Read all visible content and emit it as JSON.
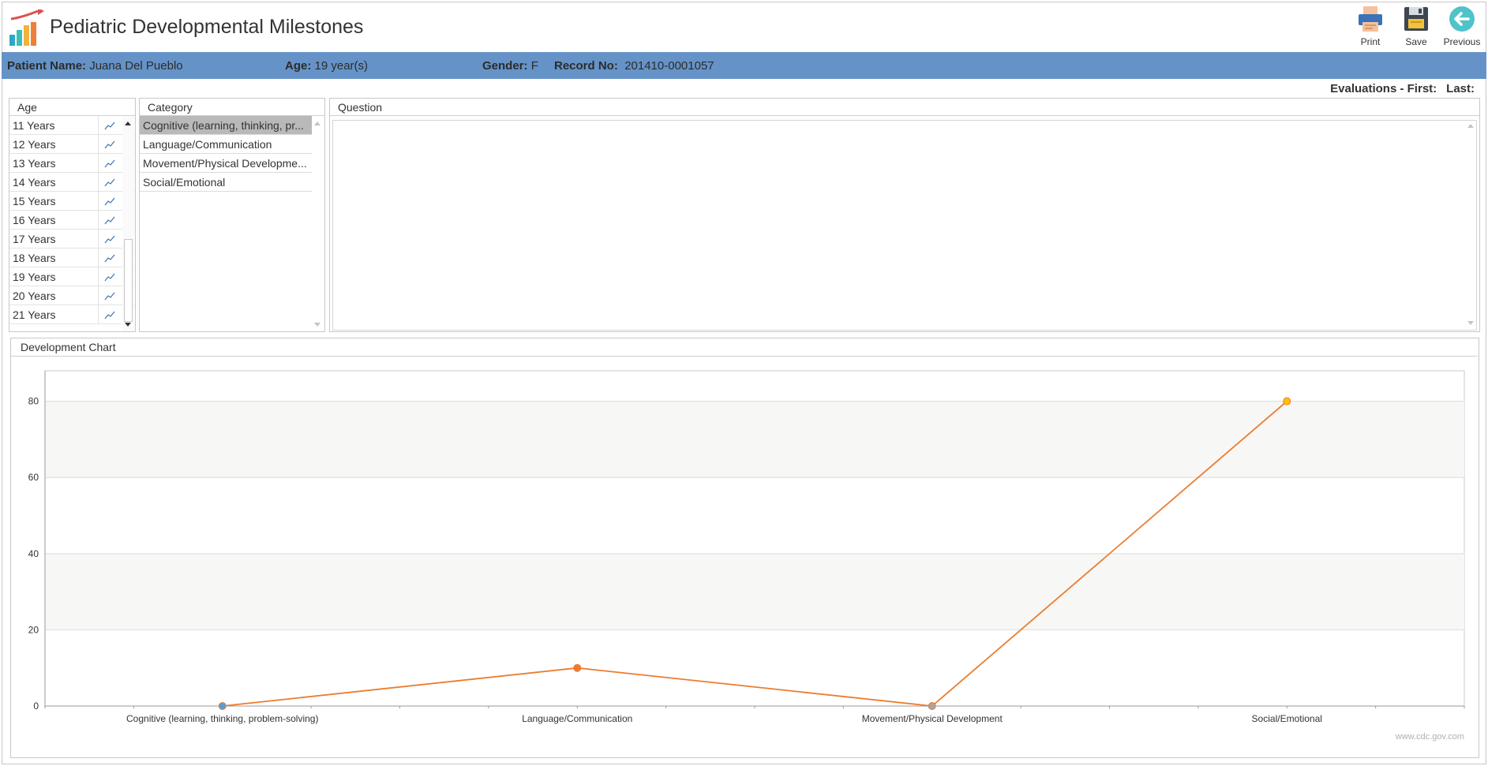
{
  "app": {
    "title": "Pediatric Developmental Milestones"
  },
  "toolbar": {
    "print_label": "Print",
    "save_label": "Save",
    "previous_label": "Previous"
  },
  "patient": {
    "name_label": "Patient Name:",
    "name": "Juana Del Pueblo",
    "age_label": "Age:",
    "age": "19 year(s)",
    "gender_label": "Gender:",
    "gender": "F",
    "record_label": "Record No:",
    "record": "201410-0001057"
  },
  "evaluations": {
    "label": "Evaluations - First:",
    "last_label": "Last:"
  },
  "panels": {
    "age_header": "Age",
    "category_header": "Category",
    "question_header": "Question",
    "chart_header": "Development Chart"
  },
  "ages": [
    "11 Years",
    "12 Years",
    "13 Years",
    "14 Years",
    "15 Years",
    "16 Years",
    "17 Years",
    "18 Years",
    "19 Years",
    "20 Years",
    "21 Years"
  ],
  "categories": [
    "Cognitive (learning, thinking, pr...",
    "Language/Communication",
    "Movement/Physical Developme...",
    "Social/Emotional"
  ],
  "selected_category": 0,
  "icons": {
    "age_row": "line-chart-icon",
    "print": "printer-icon",
    "save": "floppy-disk-icon",
    "previous": "arrow-left-circle-icon",
    "logo": "bar-chart-logo"
  },
  "colors": {
    "patient_bar": "#6593c7",
    "series_line": "#ec7c30",
    "selected_row": "#b9b9b9",
    "previous_button": "#4ec3c9"
  },
  "chart_data": {
    "type": "line",
    "categories": [
      "Cognitive (learning, thinking, problem-solving)",
      "Language/Communication",
      "Movement/Physical Development",
      "Social/Emotional"
    ],
    "values": [
      0,
      10,
      0,
      80
    ],
    "point_colors": [
      "#5b9bd5",
      "#ec7c30",
      "#a5a5a5",
      "#ffc000"
    ],
    "ylim": [
      0,
      88
    ],
    "yticks": [
      0,
      20,
      40,
      60,
      80
    ],
    "grid": true,
    "watermark": "www.cdc.gov.com"
  }
}
